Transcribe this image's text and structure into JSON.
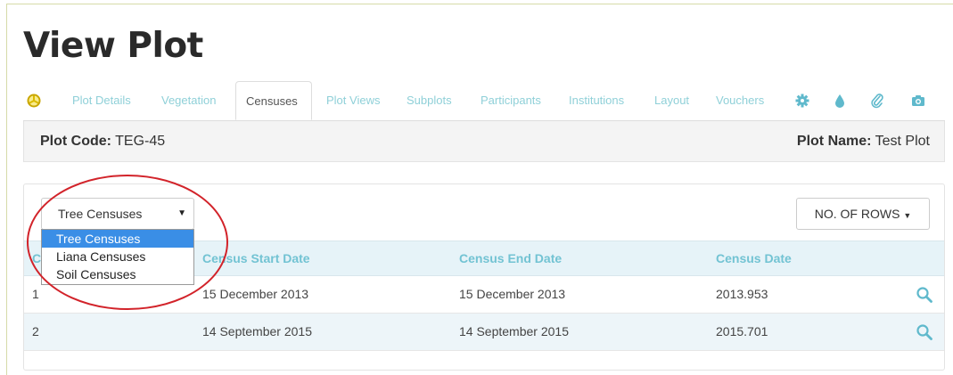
{
  "page": {
    "title": "View Plot"
  },
  "tabs": {
    "items": [
      {
        "label": "Plot Details"
      },
      {
        "label": "Vegetation"
      },
      {
        "label": "Censuses"
      },
      {
        "label": "Plot Views"
      },
      {
        "label": "Subplots"
      },
      {
        "label": "Participants"
      },
      {
        "label": "Institutions"
      },
      {
        "label": "Layout"
      },
      {
        "label": "Vouchers"
      }
    ],
    "active": "Censuses",
    "icons": [
      "globe-icon",
      "gear-icon",
      "drop-icon",
      "paperclip-icon",
      "camera-icon"
    ]
  },
  "plot_info": {
    "code_label": "Plot Code:",
    "code_value": "TEG-45",
    "name_label": "Plot Name:",
    "name_value": "Test Plot"
  },
  "controls": {
    "census_select": "Tree Censuses",
    "rows_button": "NO. OF ROWS"
  },
  "dropdown": {
    "options": [
      "Tree Censuses",
      "Liana Censuses",
      "Soil Censuses"
    ],
    "selected": "Tree Censuses"
  },
  "table": {
    "headers": [
      "C",
      "Census Start Date",
      "Census End Date",
      "Census Date"
    ],
    "rows": [
      {
        "no": "1",
        "start": "15 December 2013",
        "end": "15 December 2013",
        "date": "2013.953"
      },
      {
        "no": "2",
        "start": "14 September 2015",
        "end": "14 September 2015",
        "date": "2015.701"
      }
    ]
  },
  "colors": {
    "accent": "#72c3d3",
    "tab_text": "#8fd0d8",
    "header_bg": "#e6f3f8",
    "selection": "#3a8ee6",
    "annotation": "#d2232a",
    "globe_icon": "#e8c400"
  }
}
